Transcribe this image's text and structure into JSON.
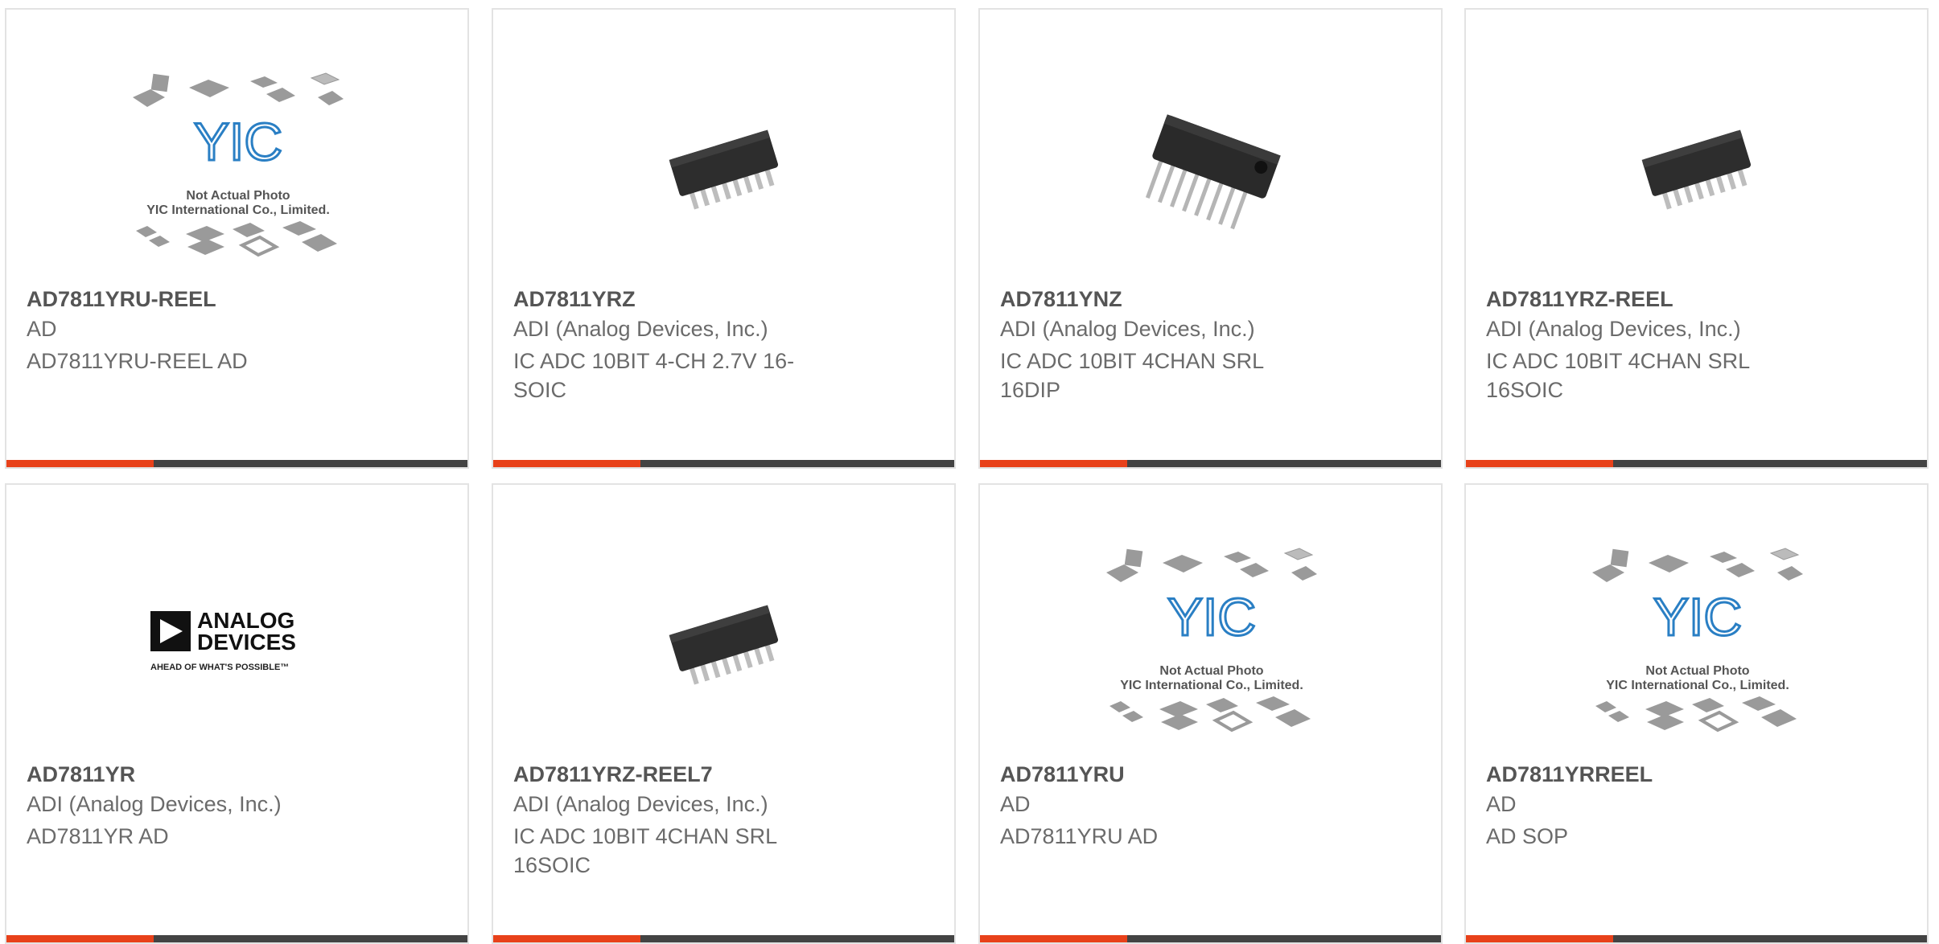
{
  "colors": {
    "accent": "#e8411a",
    "bar": "#434343",
    "border": "#e3e3e3",
    "text": "#6b6b6b",
    "title": "#555555"
  },
  "placeholder": {
    "line1": "Not Actual Photo",
    "line2": "YIC International Co., Limited.",
    "logo": "YIC"
  },
  "products": [
    {
      "part": "AD7811YRU-REEL",
      "manufacturer": "AD",
      "description": "AD7811YRU-REEL AD",
      "image": "yic-placeholder"
    },
    {
      "part": "AD7811YRZ",
      "manufacturer": "ADI (Analog Devices, Inc.)",
      "description": "IC ADC 10BIT 4-CH 2.7V 16-SOIC",
      "image": "soic-chip"
    },
    {
      "part": "AD7811YNZ",
      "manufacturer": "ADI (Analog Devices, Inc.)",
      "description": "IC ADC 10BIT 4CHAN SRL 16DIP",
      "image": "dip-chip"
    },
    {
      "part": "AD7811YRZ-REEL",
      "manufacturer": "ADI (Analog Devices, Inc.)",
      "description": "IC ADC 10BIT 4CHAN SRL 16SOIC",
      "image": "soic-chip"
    },
    {
      "part": "AD7811YR",
      "manufacturer": "ADI (Analog Devices, Inc.)",
      "description": "AD7811YR AD",
      "image": "analog-devices-logo"
    },
    {
      "part": "AD7811YRZ-REEL7",
      "manufacturer": "ADI (Analog Devices, Inc.)",
      "description": "IC ADC 10BIT 4CHAN SRL 16SOIC",
      "image": "soic-chip"
    },
    {
      "part": "AD7811YRU",
      "manufacturer": "AD",
      "description": "AD7811YRU AD",
      "image": "yic-placeholder"
    },
    {
      "part": "AD7811YRREEL",
      "manufacturer": "AD",
      "description": "AD SOP",
      "image": "yic-placeholder"
    }
  ],
  "brand_logo": {
    "line1": "ANALOG",
    "line2": "DEVICES",
    "tagline": "AHEAD OF WHAT'S POSSIBLE™"
  }
}
